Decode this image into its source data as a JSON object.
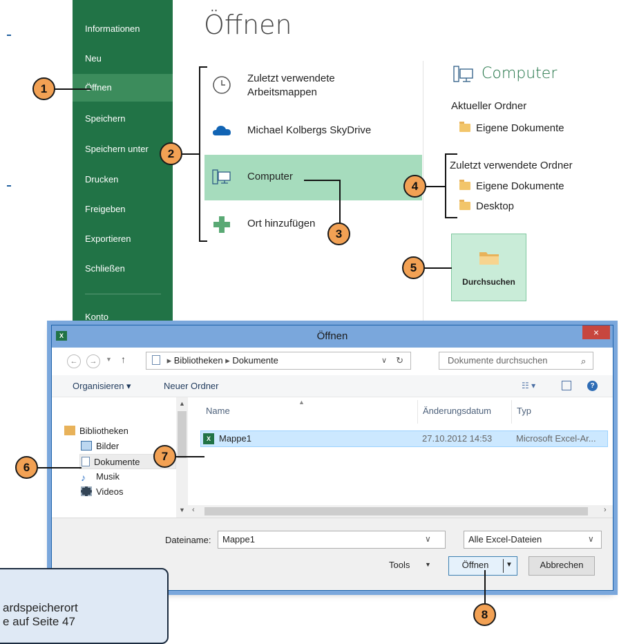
{
  "backstage": {
    "title": "Öffnen",
    "nav": [
      "Informationen",
      "Neu",
      "Öffnen",
      "Speichern",
      "Speichern unter",
      "Drucken",
      "Freigeben",
      "Exportieren",
      "Schließen",
      "Konto"
    ],
    "selected_nav": "Öffnen",
    "places": [
      {
        "label": "Zuletzt verwendete\nArbeitsmappen",
        "icon": "clock-icon"
      },
      {
        "label": "Michael Kolbergs SkyDrive",
        "icon": "cloud-icon"
      },
      {
        "label": "Computer",
        "icon": "computer-icon",
        "selected": true
      },
      {
        "label": "Ort hinzufügen",
        "icon": "plus-icon"
      }
    ],
    "computer_panel": {
      "title": "Computer",
      "current_folder_heading": "Aktueller Ordner",
      "current_folder": "Eigene Dokumente",
      "recent_heading": "Zuletzt verwendete Ordner",
      "recent_folders": [
        "Eigene Dokumente",
        "Desktop"
      ],
      "browse_button": "Durchsuchen"
    }
  },
  "dialog": {
    "app_icon_text": "X",
    "title": "Öffnen",
    "close": "×",
    "nav_back": "←",
    "nav_forward": "→",
    "nav_up": "↑",
    "breadcrumb": [
      "Bibliotheken",
      "Dokumente"
    ],
    "search_placeholder": "Dokumente durchsuchen",
    "toolbar": {
      "organize": "Organisieren ▾",
      "new_folder": "Neuer Ordner"
    },
    "tree": [
      "Bibliotheken",
      "Bilder",
      "Dokumente",
      "Musik",
      "Videos"
    ],
    "selected_tree": "Dokumente",
    "columns": {
      "name": "Name",
      "date": "Änderungsdatum",
      "type": "Typ"
    },
    "files": [
      {
        "name": "Mappe1",
        "date": "27.10.2012 14:53",
        "type": "Microsoft Excel-Ar..."
      }
    ],
    "filename_label": "Dateiname:",
    "filename_value": "Mappe1",
    "filetype": "Alle Excel-Dateien",
    "tools": "Tools",
    "open_button": "Öffnen",
    "cancel_button": "Abbrechen"
  },
  "callouts": [
    "1",
    "2",
    "3",
    "4",
    "5",
    "6",
    "7",
    "8"
  ],
  "tip": {
    "text": "ardspeicherort\ne auf Seite 47"
  },
  "colors": {
    "excel_green": "#217346",
    "nav_selected": "#3c8c5c",
    "place_selected": "#a6dcbd",
    "callout": "#f2a154",
    "dialog_frame": "#7aa7dc",
    "tip_bg": "#dfe9f5"
  }
}
